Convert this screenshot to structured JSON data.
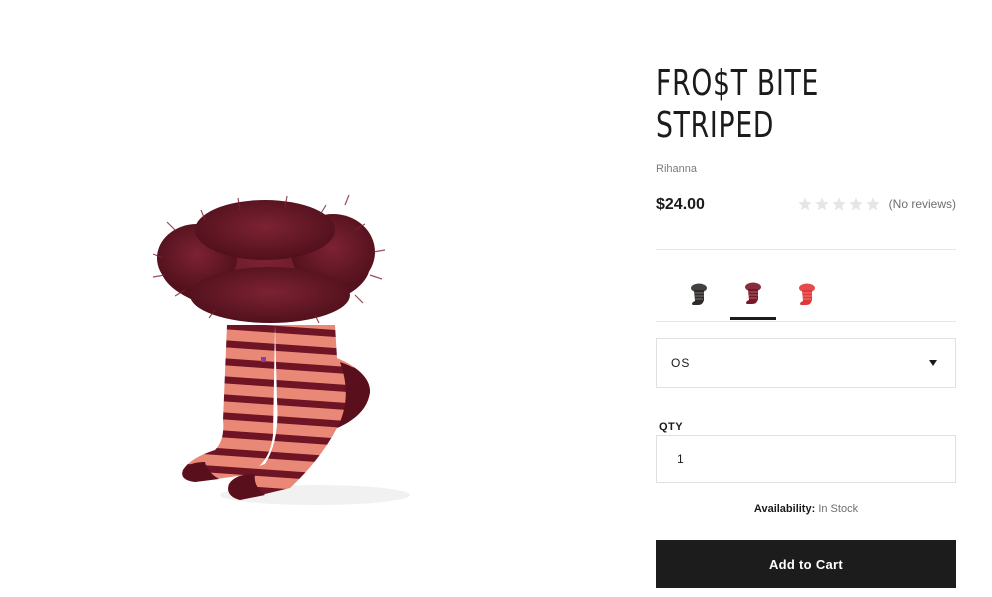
{
  "product": {
    "title_line1": "FRO$T BITE",
    "title_line2": "STRIPED",
    "brand": "Rihanna",
    "price": "$24.00",
    "rating": {
      "stars_filled": 0,
      "stars_total": 5,
      "review_text": "(No reviews)"
    },
    "swatches": [
      {
        "name": "black",
        "color": "#2f2b2a",
        "selected": false
      },
      {
        "name": "burgundy",
        "color": "#7a1626",
        "selected": true
      },
      {
        "name": "red",
        "color": "#e0383a",
        "selected": false
      }
    ],
    "size": {
      "selected": "OS"
    },
    "quantity": {
      "label": "QTY",
      "value": "1"
    },
    "availability": {
      "label": "Availability:",
      "value": "In Stock"
    },
    "cta": {
      "label": "Add to Cart"
    }
  },
  "colors": {
    "accent": "#1c1c1c",
    "sock_stripe_dark": "#6e1424",
    "sock_stripe_light": "#e98876",
    "fur": "#6f1a28",
    "star_empty": "#e6e6e6"
  },
  "icons": {
    "star": "star-icon",
    "caret": "chevron-down-icon"
  }
}
